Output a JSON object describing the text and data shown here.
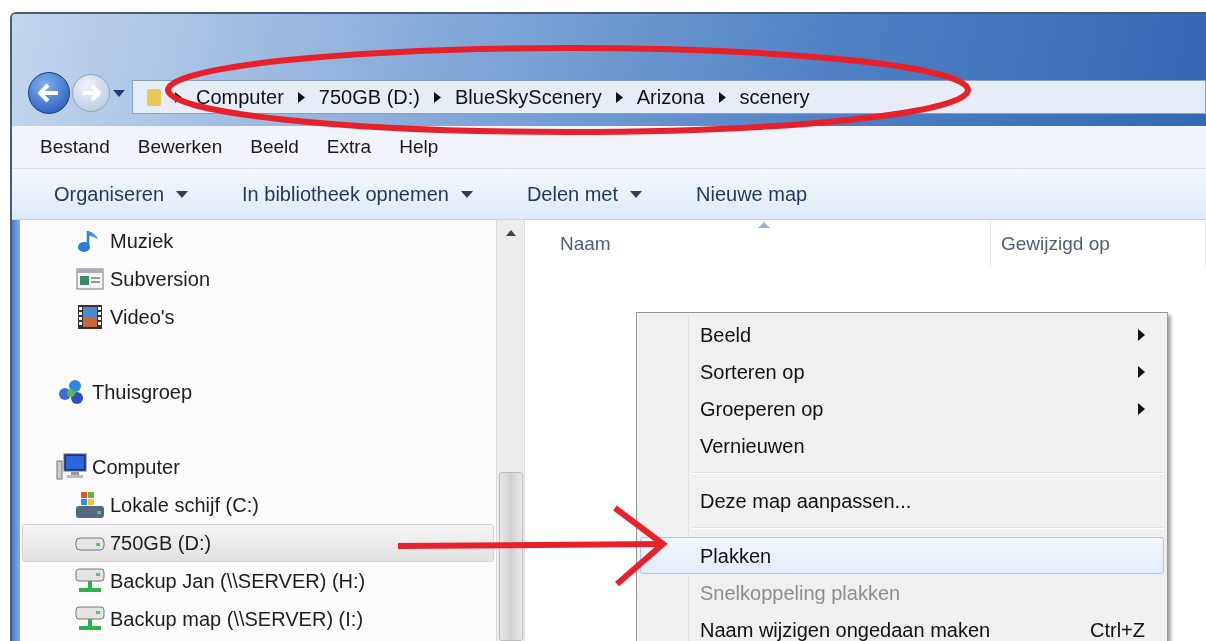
{
  "address_bar": {
    "crumbs": [
      "Computer",
      "750GB (D:)",
      "BlueSkyScenery",
      "Arizona",
      "scenery"
    ]
  },
  "menu_bar": [
    "Bestand",
    "Bewerken",
    "Beeld",
    "Extra",
    "Help"
  ],
  "toolbar": [
    {
      "label": "Organiseren",
      "dropdown": true
    },
    {
      "label": "In bibliotheek opnemen",
      "dropdown": true
    },
    {
      "label": "Delen met",
      "dropdown": true
    },
    {
      "label": "Nieuwe map",
      "dropdown": false
    }
  ],
  "navigation_pane": {
    "sections": [
      {
        "children": [
          {
            "label": "Muziek",
            "kind": "music",
            "selected": false
          },
          {
            "label": "Subversion",
            "kind": "window",
            "selected": false
          },
          {
            "label": "Video's",
            "kind": "film",
            "selected": false
          }
        ]
      },
      {
        "label": "Thuisgroep",
        "kind": "homegroup",
        "selected": false
      },
      {
        "label": "Computer",
        "kind": "computer",
        "selected": false,
        "children": [
          {
            "label": "Lokale schijf (C:)",
            "kind": "system-drive",
            "selected": false
          },
          {
            "label": "750GB (D:)",
            "kind": "drive",
            "selected": true
          },
          {
            "label": "Backup Jan (\\\\SERVER) (H:)",
            "kind": "network-drive",
            "selected": false
          },
          {
            "label": "Backup map (\\\\SERVER) (I:)",
            "kind": "network-drive",
            "selected": false
          }
        ]
      }
    ]
  },
  "file_list": {
    "columns": [
      {
        "label": "Naam",
        "sorted": true
      },
      {
        "label": "Gewijzigd op",
        "sorted": false
      }
    ]
  },
  "context_menu": {
    "items": [
      {
        "kind": "item",
        "label": "Beeld",
        "submenu": true,
        "selected": false,
        "disabled": false
      },
      {
        "kind": "item",
        "label": "Sorteren op",
        "submenu": true,
        "selected": false,
        "disabled": false
      },
      {
        "kind": "item",
        "label": "Groeperen op",
        "submenu": true,
        "selected": false,
        "disabled": false
      },
      {
        "kind": "item",
        "label": "Vernieuwen",
        "submenu": false,
        "selected": false,
        "disabled": false
      },
      {
        "kind": "separator"
      },
      {
        "kind": "item",
        "label": "Deze map aanpassen...",
        "submenu": false,
        "selected": false,
        "disabled": false
      },
      {
        "kind": "separator"
      },
      {
        "kind": "item",
        "label": "Plakken",
        "submenu": false,
        "selected": true,
        "disabled": false
      },
      {
        "kind": "item",
        "label": "Snelkoppeling plakken",
        "submenu": false,
        "selected": false,
        "disabled": true
      },
      {
        "kind": "item",
        "label": "Naam wijzigen ongedaan maken",
        "shortcut": "Ctrl+Z",
        "submenu": false,
        "selected": false,
        "disabled": false
      }
    ]
  }
}
